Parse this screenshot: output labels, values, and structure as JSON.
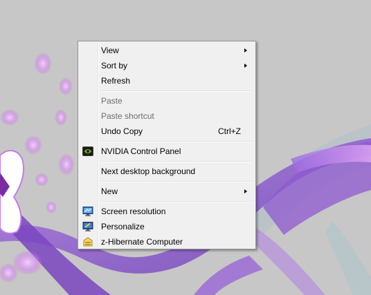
{
  "context_menu": {
    "items": [
      {
        "label": "View",
        "has_submenu": true
      },
      {
        "label": "Sort by",
        "has_submenu": true
      },
      {
        "label": "Refresh"
      },
      {
        "label": "Paste",
        "disabled": true
      },
      {
        "label": "Paste shortcut",
        "disabled": true
      },
      {
        "label": "Undo Copy",
        "shortcut": "Ctrl+Z"
      },
      {
        "label": "NVIDIA Control Panel",
        "icon": "nvidia-icon"
      },
      {
        "label": "Next desktop background"
      },
      {
        "label": "New",
        "has_submenu": true
      },
      {
        "label": "Screen resolution",
        "icon": "screen-resolution-icon"
      },
      {
        "label": "Personalize",
        "icon": "personalize-icon"
      },
      {
        "label": "z-Hibernate Computer",
        "icon": "hibernate-icon"
      }
    ]
  },
  "colors": {
    "desktop_background": "#c6c6c6",
    "menu_background": "#f0f0f0",
    "menu_border": "#979797",
    "wallpaper_purple": "#8a55c8",
    "wallpaper_pink": "#d98cf0"
  }
}
